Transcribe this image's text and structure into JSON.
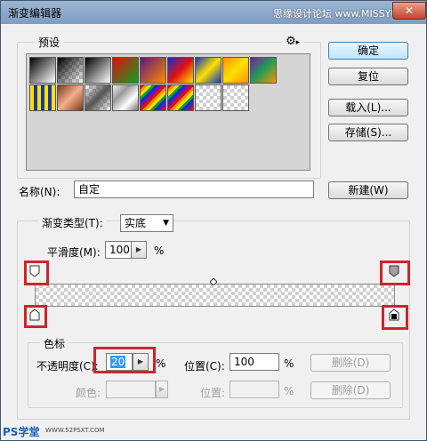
{
  "window": {
    "title": "渐变编辑器",
    "watermark": "思缘设计论坛 www.MISSYUAN.COM",
    "close_glyph": "✕"
  },
  "presets": {
    "label": "预设",
    "gear_glyph": "⚙",
    "menu_glyph": "▸"
  },
  "buttons": {
    "ok": "确定",
    "reset": "复位",
    "load": "载入(L)...",
    "save": "存储(S)...",
    "new": "新建(W)"
  },
  "name": {
    "label": "名称(N):",
    "value": "自定"
  },
  "gradient_type": {
    "label": "渐变类型(T):",
    "value": "实底"
  },
  "smoothness": {
    "label": "平滑度(M):",
    "value": "100",
    "unit": "%"
  },
  "stops": {
    "group_label": "色标",
    "opacity_label": "不透明度(C):",
    "opacity_value": "20",
    "opacity_unit": "%",
    "location_label": "位置(C):",
    "location_value": "100",
    "location_unit": "%",
    "delete_label": "删除(D)",
    "color_label": "颜色:",
    "color_location_label": "位置:",
    "color_location_unit": "%",
    "color_delete_label": "删除(D)"
  },
  "footer": {
    "logo_text": "PS学堂",
    "logo_url": "WWW.52PSXT.COM"
  },
  "colors": {
    "highlight_box": "#d2222a",
    "primary_button": "#3c7fb1"
  }
}
